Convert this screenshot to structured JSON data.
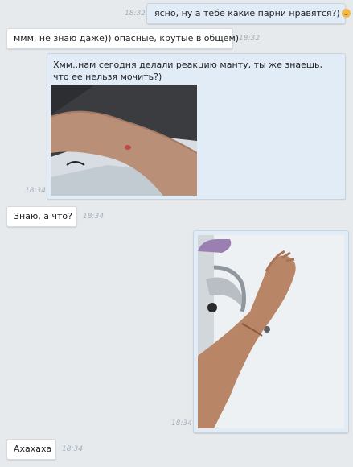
{
  "messages": [
    {
      "text": "ясно, ну а тебе какие парни нравятся?)",
      "time": "18:32",
      "emoji": "smiling-face"
    },
    {
      "text": "ммм, не знаю даже)) опасные, крутые в общем)",
      "time": "18:32"
    },
    {
      "text": "Хмм..нам сегодня делали реакцию манту, ты же знаешь, что ее нельзя мочить?)",
      "time": "18:34",
      "photo": "forearm-with-mantoux-test"
    },
    {
      "text": "Знаю, а что?",
      "time": "18:34"
    },
    {
      "text": "",
      "time": "18:34",
      "photo": "arm-over-sink"
    },
    {
      "text": "Ахахаха",
      "time": "18:34"
    }
  ],
  "colors": {
    "background": "#e6eaed",
    "outgoing_bubble": "#e2ecf7",
    "incoming_bubble": "#ffffff",
    "timestamp": "#a6b0ba"
  }
}
